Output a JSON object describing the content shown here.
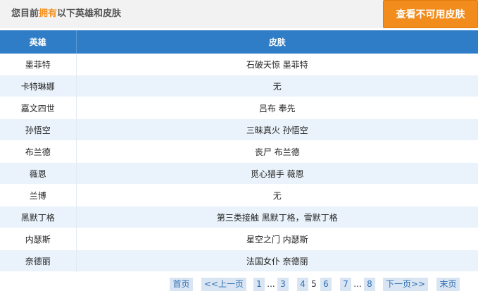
{
  "header": {
    "title_prefix": "您目前",
    "title_highlight": "拥有",
    "title_suffix": "以下英雄和皮肤",
    "button_label": "查看不可用皮肤"
  },
  "table": {
    "headers": [
      "英雄",
      "皮肤"
    ],
    "rows": [
      {
        "hero": "墨菲特",
        "skin": "石破天惊 墨菲特"
      },
      {
        "hero": "卡特琳娜",
        "skin": "无"
      },
      {
        "hero": "嘉文四世",
        "skin": "吕布 奉先"
      },
      {
        "hero": "孙悟空",
        "skin": "三昧真火 孙悟空"
      },
      {
        "hero": "布兰德",
        "skin": "丧尸 布兰德"
      },
      {
        "hero": "薇恩",
        "skin": "觅心猎手 薇恩"
      },
      {
        "hero": "兰博",
        "skin": "无"
      },
      {
        "hero": "黑默丁格",
        "skin": "第三类接触 黑默丁格，雪默丁格"
      },
      {
        "hero": "内瑟斯",
        "skin": "星空之门 内瑟斯"
      },
      {
        "hero": "奈德丽",
        "skin": "法国女仆 奈德丽"
      }
    ]
  },
  "pager": {
    "first": "首页",
    "prev": "<<上一页",
    "page1": "1",
    "ellipsis1": "...",
    "page3": "3",
    "page4": "4",
    "current": "5",
    "page6": "6",
    "page7": "7",
    "ellipsis2": "...",
    "page8": "8",
    "next": "下一页>>",
    "last": "末页"
  }
}
